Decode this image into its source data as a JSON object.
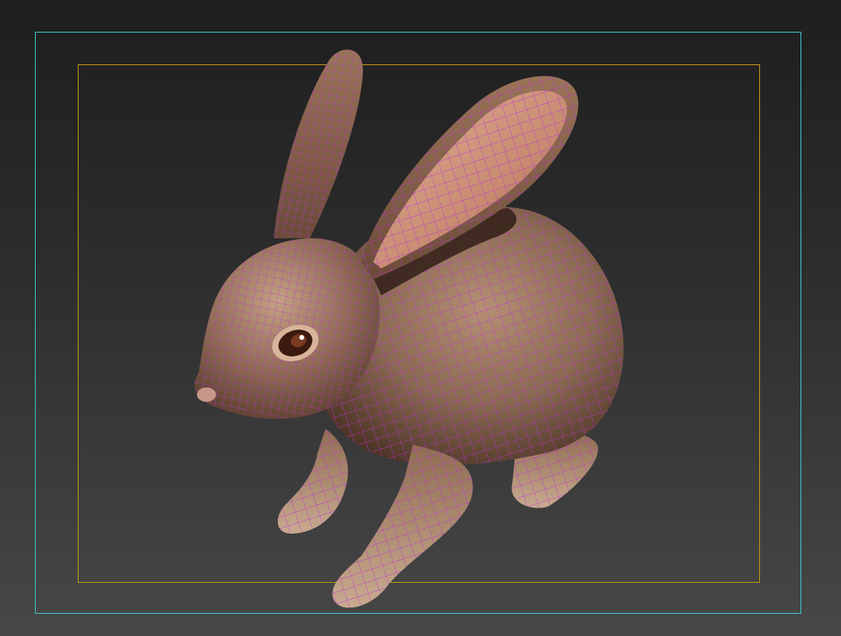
{
  "viewport": {
    "background_top": "#1e1e1e",
    "background_bottom": "#474747"
  },
  "frames": {
    "outer_color": "#3fc7d0",
    "inner_color": "#c89a1a"
  },
  "model": {
    "name_icon": "rabbit-model",
    "fur_color": "#8a6a52",
    "fur_light": "#b58f74",
    "fur_dark": "#4f3628",
    "ear_inner": "#d69c84",
    "wire_color": "#c030d8",
    "eye_color": "#3b1a10"
  }
}
